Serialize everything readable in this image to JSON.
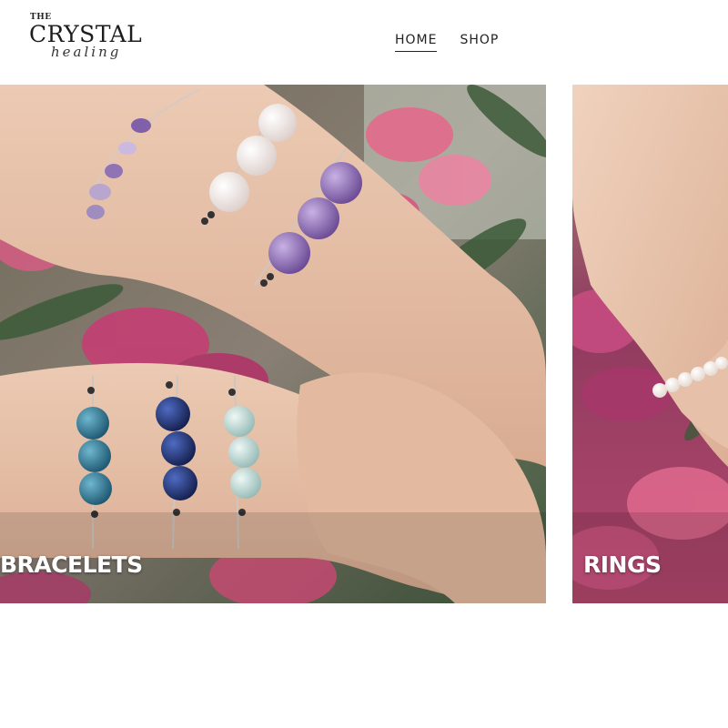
{
  "brand": {
    "the": "THE",
    "name": "CRYSTAL",
    "script": "healing"
  },
  "nav": {
    "items": [
      {
        "label": "HOME",
        "active": true
      },
      {
        "label": "SHOP",
        "active": false
      }
    ]
  },
  "categories": [
    {
      "label": "BRACELETS",
      "image": "photo of wrists wearing beaded crystal bracelets"
    },
    {
      "label": "RINGS",
      "image": "photo of a wrist wearing a white moonstone bead bracelet"
    }
  ],
  "colors": {
    "text": "#222222",
    "background": "#ffffff",
    "label": "#ffffff",
    "amethyst": "#8f6bb5",
    "clear_quartz": "#f3ece9",
    "apatite": "#2f7d9a",
    "lapis": "#22357a",
    "amazonite": "#bcd8d4",
    "flower_pink": "#e26a8c",
    "skin": "#e8c2a9"
  }
}
